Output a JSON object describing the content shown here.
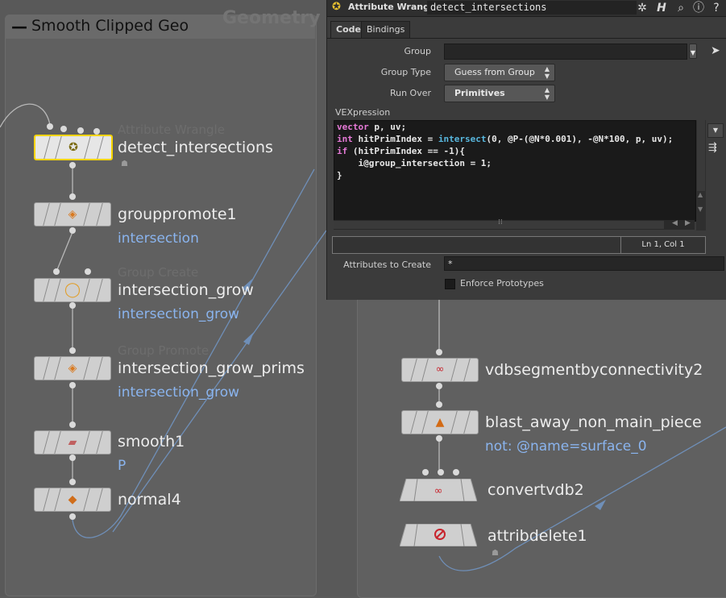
{
  "network": {
    "box_title": "Smooth Clipped Geo",
    "context_label": "Geometry",
    "left_nodes": [
      {
        "name": "detect_intersections",
        "type": "Attribute Wrangle",
        "comment": ""
      },
      {
        "name": "grouppromote1",
        "type": "",
        "comment": "intersection"
      },
      {
        "name": "intersection_grow",
        "type": "Group Create",
        "comment": "intersection_grow"
      },
      {
        "name": "intersection_grow_prims",
        "type": "Group Promote",
        "comment": "intersection_grow"
      },
      {
        "name": "smooth1",
        "type": "",
        "comment": "P"
      },
      {
        "name": "normal4",
        "type": "",
        "comment": ""
      }
    ],
    "right_nodes": [
      {
        "name": "vdbsegmentbyconnectivity2",
        "comment": ""
      },
      {
        "name": "blast_away_non_main_piece",
        "comment": "not: @name=surface_0"
      },
      {
        "name": "convertvdb2",
        "comment": ""
      },
      {
        "name": "attribdelete1",
        "comment": ""
      }
    ]
  },
  "panel": {
    "node_type": "Attribute Wrangle",
    "node_name": "detect_intersections",
    "tabs": [
      "Code",
      "Bindings"
    ],
    "group_label": "Group",
    "group_value": "",
    "group_type_label": "Group Type",
    "group_type_value": "Guess from Group",
    "run_over_label": "Run Over",
    "run_over_value": "Primitives",
    "vexpression_label": "VEXpression",
    "cursor_position": "Ln 1, Col 1",
    "attributes_label": "Attributes to Create",
    "attributes_value": "*",
    "enforce_label": "Enforce Prototypes",
    "code_lines": [
      "vector p, uv;",
      "int hitPrimIndex = intersect(0, @P-(@N*0.001), -@N*100, p, uv);",
      "if (hitPrimIndex == -1){",
      "    i@group_intersection = 1;",
      "}"
    ]
  }
}
